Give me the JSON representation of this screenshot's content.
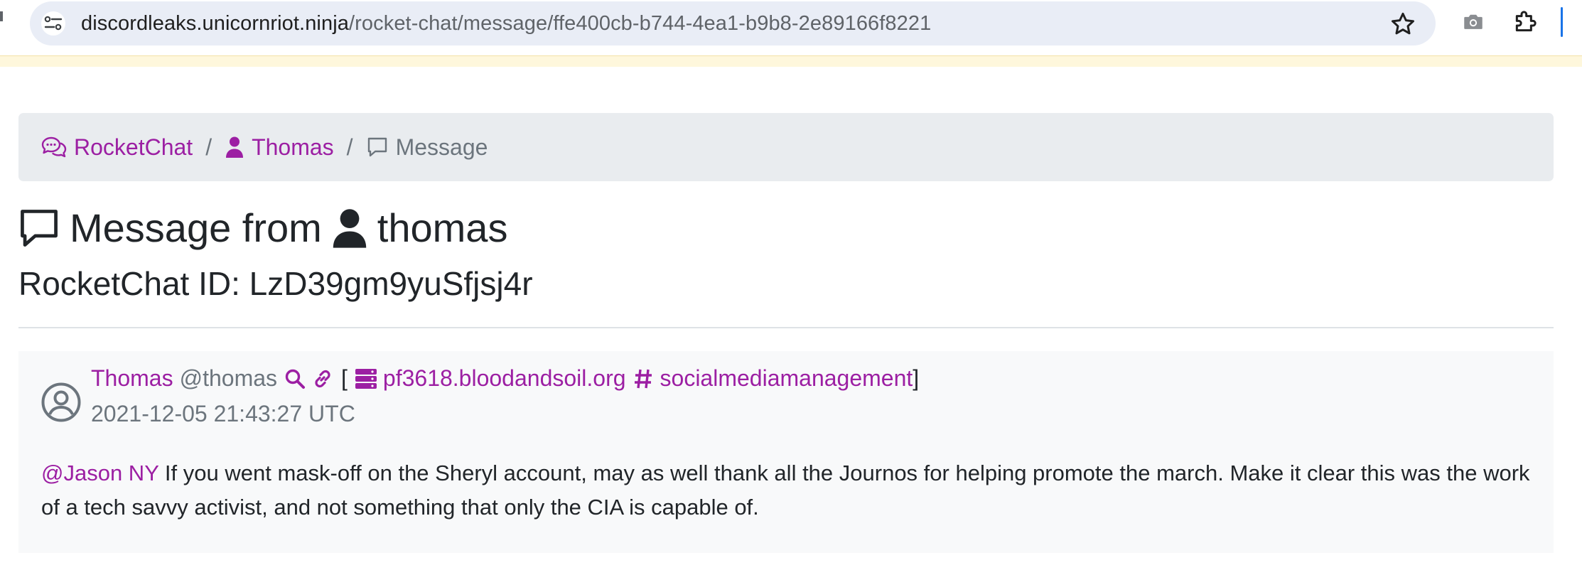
{
  "browser": {
    "url_host": "discordleaks.unicornriot.ninja",
    "url_path": "/rocket-chat/message/ffe400cb-b744-4ea1-b9b8-2e89166f8221"
  },
  "breadcrumb": {
    "items": [
      {
        "label": "RocketChat",
        "icon": "comments-icon"
      },
      {
        "label": "Thomas",
        "icon": "user-icon"
      }
    ],
    "separator": "/",
    "active": {
      "label": "Message",
      "icon": "comment-icon"
    }
  },
  "heading": {
    "prefix": "Message from",
    "username": "thomas",
    "subtitle": "RocketChat ID: LzD39gm9yuSfjsj4r"
  },
  "message": {
    "display_name": "Thomas",
    "handle": "@thomas",
    "bracket_open": "[",
    "server": "pf3618.bloodandsoil.org",
    "channel": "socialmediamanagement",
    "bracket_close": "]",
    "timestamp": "2021-12-05 21:43:27 UTC",
    "mention": "@Jason NY",
    "text": " If you went mask-off on the Sheryl account, may as well thank all the Journos for helping promote the march. Make it clear this was the work of a tech savvy activist, and not something that only the CIA is capable of."
  },
  "colors": {
    "link": "#9c1fa3",
    "muted": "#6c757d",
    "breadcrumb_bg": "#e9ecef",
    "card_bg": "#f8f9fa"
  }
}
